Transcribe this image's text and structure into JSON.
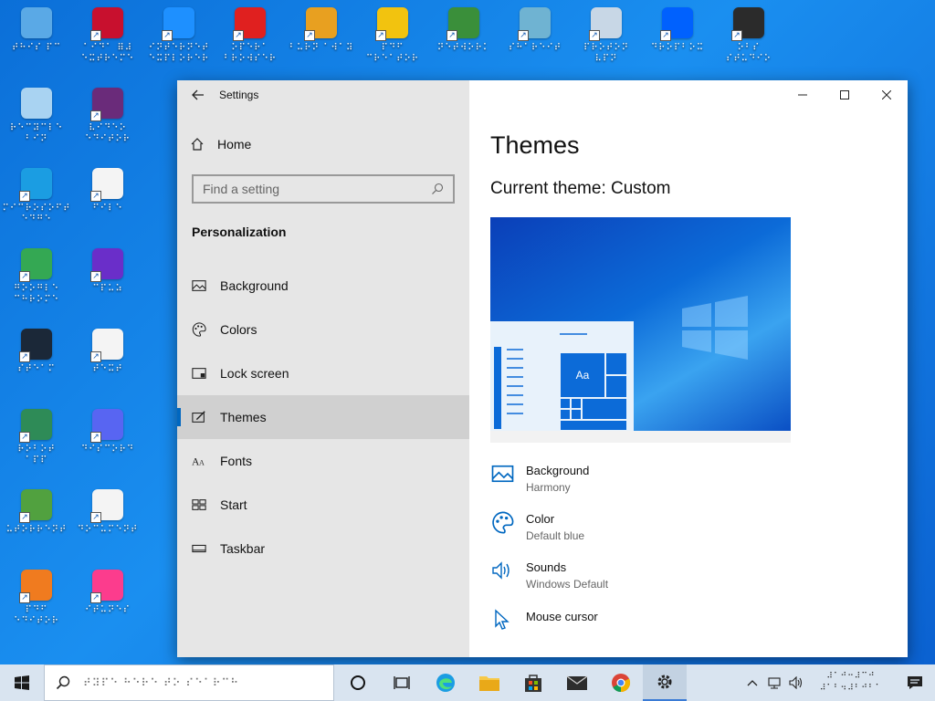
{
  "desktop": {
    "icons": [
      {
        "name": "this-pc",
        "label": "⠞⠓⠊⠎ ⠏⠉",
        "color": "#5aa9e6"
      },
      {
        "name": "app-64",
        "label": "⠁⠊⠙⠁ ⠿⠼\n⠑⠭⠞⠗⠑⠍⠑",
        "color": "#c8102e"
      },
      {
        "name": "internet-explorer",
        "label": "⠊⠝⠞⠑⠗⠝⠑⠞\n⠑⠭⠏⠇⠕⠗⠑⠗",
        "color": "#1e90ff"
      },
      {
        "name": "opera",
        "label": "⠕⠏⠑⠗⠁\n⠃⠗⠕⠺⠎⠑⠗",
        "color": "#e0201f"
      },
      {
        "name": "disc-app",
        "label": "⠃⠥⠗⠝ ⠁⠺⠁⠽",
        "color": "#e8a020"
      },
      {
        "name": "pdf-app",
        "label": "⠏⠙⠋ ⠉⠗⠑⠁⠞⠕⠗",
        "color": "#f2c30f"
      },
      {
        "name": "network-app",
        "label": "⠝⠑⠞⠺⠕⠗⠅",
        "color": "#3a8f3a"
      },
      {
        "name": "share-app",
        "label": "⠎⠓⠁⠗⠑⠊⠞",
        "color": "#6fb3d2"
      },
      {
        "name": "vpn-app",
        "label": "⠏⠗⠕⠞⠕⠝\n⠧⠏⠝",
        "color": "#c8d7e6"
      },
      {
        "name": "dropbox",
        "label": "⠙⠗⠕⠏⠃⠕⠭",
        "color": "#0061fe"
      },
      {
        "name": "obs",
        "label": "⠕⠃⠎\n⠎⠞⠥⠙⠊⠕",
        "color": "#2b2b2b"
      },
      {
        "name": "recycle-bin",
        "label": "⠗⠑⠉⠽⠉⠇⠑\n⠃⠊⠝",
        "color": "#a9d3f2"
      },
      {
        "name": "video-app",
        "label": "⠧⠊⠙⠑⠕\n⠑⠙⠊⠞⠕⠗",
        "color": "#6a2b7a"
      },
      {
        "name": "edge",
        "label": "⠍⠊⠉⠗⠕⠎⠕⠋⠞\n⠑⠙⠛⠑",
        "color": "#1b9de2"
      },
      {
        "name": "file-doc",
        "label": "⠋⠊⠇⠑",
        "color": "#f4f4f4"
      },
      {
        "name": "chrome",
        "label": "⠛⠕⠕⠛⠇⠑\n⠉⠓⠗⠕⠍⠑",
        "color": "#34a853"
      },
      {
        "name": "cpu-app",
        "label": "⠉⠏⠥⠵",
        "color": "#6a2ec9"
      },
      {
        "name": "steam",
        "label": "⠎⠞⠑⠁⠍",
        "color": "#1b2838"
      },
      {
        "name": "text-file",
        "label": "⠞⠑⠭⠞",
        "color": "#f4f4f4"
      },
      {
        "name": "robot-app",
        "label": "⠗⠕⠃⠕⠞\n⠁⠏⠏",
        "color": "#2e8b57"
      },
      {
        "name": "discord",
        "label": "⠙⠊⠎⠉⠕⠗⠙",
        "color": "#5865f2"
      },
      {
        "name": "utorrent",
        "label": "⠥⠞⠕⠗⠗⠑⠝⠞",
        "color": "#51a13f"
      },
      {
        "name": "document",
        "label": "⠙⠕⠉⠥⠍⠑⠝⠞",
        "color": "#f4f4f4"
      },
      {
        "name": "pdf-editor",
        "label": "⠏⠙⠋\n⠑⠙⠊⠞⠕⠗",
        "color": "#f07b1f"
      },
      {
        "name": "itunes",
        "label": "⠊⠞⠥⠝⠑⠎",
        "color": "#fc3c8d"
      }
    ]
  },
  "settings": {
    "title": "Settings",
    "home_label": "Home",
    "search_placeholder": "Find a setting",
    "section_title": "Personalization",
    "nav_items": [
      {
        "label": "Background",
        "icon": "image-icon"
      },
      {
        "label": "Colors",
        "icon": "palette-icon"
      },
      {
        "label": "Lock screen",
        "icon": "lock-screen-icon"
      },
      {
        "label": "Themes",
        "icon": "themes-icon",
        "active": true
      },
      {
        "label": "Fonts",
        "icon": "fonts-icon"
      },
      {
        "label": "Start",
        "icon": "start-icon"
      },
      {
        "label": "Taskbar",
        "icon": "taskbar-icon"
      }
    ],
    "page_title": "Themes",
    "current_theme": "Current theme: Custom",
    "preview_tile_text": "Aa",
    "properties": [
      {
        "title": "Background",
        "sub": "Harmony",
        "icon": "image-icon"
      },
      {
        "title": "Color",
        "sub": "Default blue",
        "icon": "palette-icon"
      },
      {
        "title": "Sounds",
        "sub": "Windows Default",
        "icon": "speaker-icon"
      },
      {
        "title": "Mouse cursor",
        "sub": "",
        "icon": "cursor-icon"
      }
    ],
    "accent_color": "#0067c0"
  },
  "taskbar": {
    "search_text": "⠞⠽⠏⠑ ⠓⠑⠗⠑ ⠞⠕ ⠎⠑⠁⠗⠉⠓",
    "clock_time": "⠼⠁⠚⠒⠼⠉⠚",
    "clock_date": "⠼⠁⠃⠲⠼⠃⠚⠃⠁"
  }
}
